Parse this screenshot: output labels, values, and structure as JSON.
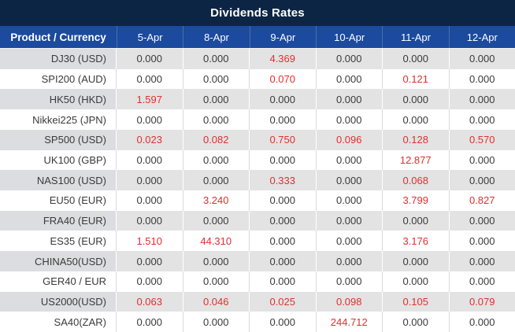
{
  "title": "Dividends Rates",
  "colors": {
    "title_bar_bg": "#0d2544",
    "header_bg": "#1b4a9e",
    "header_separator": "#4a6fae",
    "row_stripe_bg": "#e3e3e3",
    "row_stripe_first_col_bg": "#dcdde1",
    "row_white_bg": "#ffffff",
    "text_dark": "#3a3a3a",
    "value_highlight_red": "#e12f2f"
  },
  "table": {
    "header": [
      "Product / Currency",
      "5-Apr",
      "8-Apr",
      "9-Apr",
      "10-Apr",
      "11-Apr",
      "12-Apr"
    ],
    "rows": [
      {
        "product": "DJ30 (USD)",
        "values": [
          "0.000",
          "0.000",
          "4.369",
          "0.000",
          "0.000",
          "0.000"
        ],
        "red_cols": [
          2
        ]
      },
      {
        "product": "SPI200 (AUD)",
        "values": [
          "0.000",
          "0.000",
          "0.070",
          "0.000",
          "0.121",
          "0.000"
        ],
        "red_cols": [
          2,
          4
        ]
      },
      {
        "product": "HK50 (HKD)",
        "values": [
          "1.597",
          "0.000",
          "0.000",
          "0.000",
          "0.000",
          "0.000"
        ],
        "red_cols": [
          0
        ]
      },
      {
        "product": "Nikkei225 (JPN)",
        "values": [
          "0.000",
          "0.000",
          "0.000",
          "0.000",
          "0.000",
          "0.000"
        ],
        "red_cols": []
      },
      {
        "product": "SP500 (USD)",
        "values": [
          "0.023",
          "0.082",
          "0.750",
          "0.096",
          "0.128",
          "0.570"
        ],
        "red_cols": [
          0,
          1,
          2,
          3,
          4,
          5
        ]
      },
      {
        "product": "UK100 (GBP)",
        "values": [
          "0.000",
          "0.000",
          "0.000",
          "0.000",
          "12.877",
          "0.000"
        ],
        "red_cols": [
          4
        ]
      },
      {
        "product": "NAS100 (USD)",
        "values": [
          "0.000",
          "0.000",
          "0.333",
          "0.000",
          "0.068",
          "0.000"
        ],
        "red_cols": [
          2,
          4
        ]
      },
      {
        "product": "EU50 (EUR)",
        "values": [
          "0.000",
          "3.240",
          "0.000",
          "0.000",
          "3.799",
          "0.827"
        ],
        "red_cols": [
          1,
          4,
          5
        ]
      },
      {
        "product": "FRA40 (EUR)",
        "values": [
          "0.000",
          "0.000",
          "0.000",
          "0.000",
          "0.000",
          "0.000"
        ],
        "red_cols": []
      },
      {
        "product": "ES35 (EUR)",
        "values": [
          "1.510",
          "44.310",
          "0.000",
          "0.000",
          "3.176",
          "0.000"
        ],
        "red_cols": [
          0,
          1,
          4
        ]
      },
      {
        "product": "CHINA50(USD)",
        "values": [
          "0.000",
          "0.000",
          "0.000",
          "0.000",
          "0.000",
          "0.000"
        ],
        "red_cols": []
      },
      {
        "product": "GER40 / EUR",
        "values": [
          "0.000",
          "0.000",
          "0.000",
          "0.000",
          "0.000",
          "0.000"
        ],
        "red_cols": []
      },
      {
        "product": "US2000(USD)",
        "values": [
          "0.063",
          "0.046",
          "0.025",
          "0.098",
          "0.105",
          "0.079"
        ],
        "red_cols": [
          0,
          1,
          2,
          3,
          4,
          5
        ]
      },
      {
        "product": "SA40(ZAR)",
        "values": [
          "0.000",
          "0.000",
          "0.000",
          "244.712",
          "0.000",
          "0.000"
        ],
        "red_cols": [
          3
        ]
      }
    ]
  }
}
